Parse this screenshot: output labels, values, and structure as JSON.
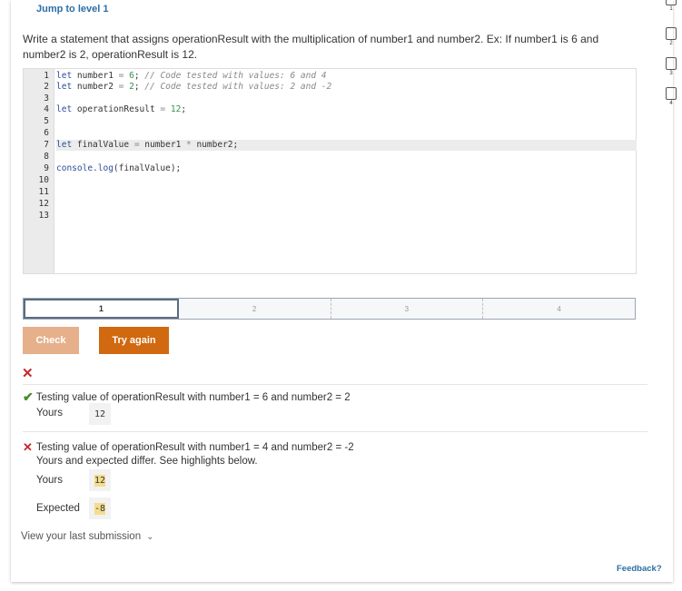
{
  "nav": {
    "jump_label": "Jump to level 1"
  },
  "prompt": {
    "text": "Write a statement that assigns operationResult with the multiplication of number1 and number2. Ex: If number1 is 6 and number2 is 2, operationResult is 12."
  },
  "editor": {
    "line_numbers": [
      "1",
      "2",
      "3",
      "4",
      "5",
      "6",
      "7",
      "8",
      "9",
      "10",
      "11",
      "12",
      "13"
    ],
    "lines": {
      "l1": {
        "kw": "let",
        "name": " number1 ",
        "op": "=",
        "num": " 6",
        "semi": "; ",
        "cmt": "// Code tested with values: 6 and 4"
      },
      "l2": {
        "kw": "let",
        "name": " number2 ",
        "op": "=",
        "num": " 2",
        "semi": "; ",
        "cmt": "// Code tested with values: 2 and -2"
      },
      "l4": {
        "kw": "let",
        "name": " operationResult ",
        "op": "=",
        "num": " 12",
        "semi": ";"
      },
      "l7": {
        "kw": "let",
        "name": " finalValue ",
        "op": "=",
        "rest1": " number1 ",
        "op2": "*",
        "rest2": " number2;"
      },
      "l9": {
        "call": "console.log",
        "rest": "(finalValue);"
      }
    }
  },
  "levels": [
    "1",
    "2",
    "3",
    "4"
  ],
  "buttons": {
    "check": "Check",
    "try_again": "Try again"
  },
  "results": {
    "status_icon": "x-mark",
    "test1": {
      "title": "Testing value of operationResult with number1 = 6 and number2 = 2",
      "yours_label": "Yours",
      "yours_value": "12"
    },
    "test2": {
      "title": "Testing value of operationResult with number1 = 4 and number2 = -2",
      "desc": "Yours and expected differ. See highlights below.",
      "yours_label": "Yours",
      "yours_value": "12",
      "expected_label": "Expected",
      "expected_value": "-8"
    }
  },
  "view_submission": "View your last submission",
  "feedback": "Feedback?",
  "side_levels": [
    "1",
    "2",
    "3",
    "4"
  ],
  "colors": {
    "link": "#2b6ea6",
    "check_btn": "#e6b08b",
    "try_btn": "#d0690f",
    "fail": "#c8282b",
    "pass": "#4b8b2a",
    "highlight": "#f4dd8c"
  }
}
